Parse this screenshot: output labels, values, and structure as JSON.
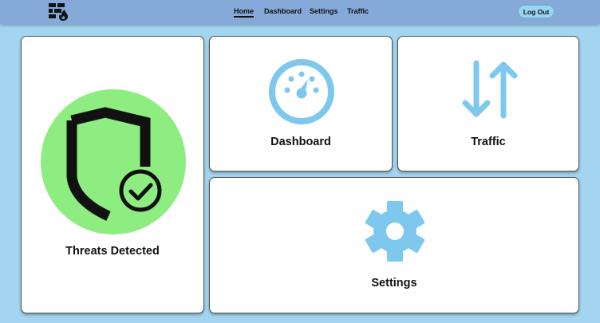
{
  "header": {
    "logo_icon": "firewall-logo-icon",
    "nav": [
      {
        "label": "Home",
        "active": true
      },
      {
        "label": "Dashboard",
        "active": false
      },
      {
        "label": "Settings",
        "active": false
      },
      {
        "label": "Traffic",
        "active": false
      }
    ],
    "logout_label": "Log Out"
  },
  "cards": {
    "threats": {
      "label": "Threats Detected",
      "icon": "shield-check-icon"
    },
    "dashboard": {
      "label": "Dashboard",
      "icon": "speedometer-icon"
    },
    "traffic": {
      "label": "Traffic",
      "icon": "up-down-arrows-icon"
    },
    "settings": {
      "label": "Settings",
      "icon": "gear-icon"
    }
  },
  "colors": {
    "page_bg": "#a3d5f0",
    "header_bg": "#85a9d9",
    "accent_icon": "#7ec8ee",
    "threat_circle": "#8ded80"
  }
}
